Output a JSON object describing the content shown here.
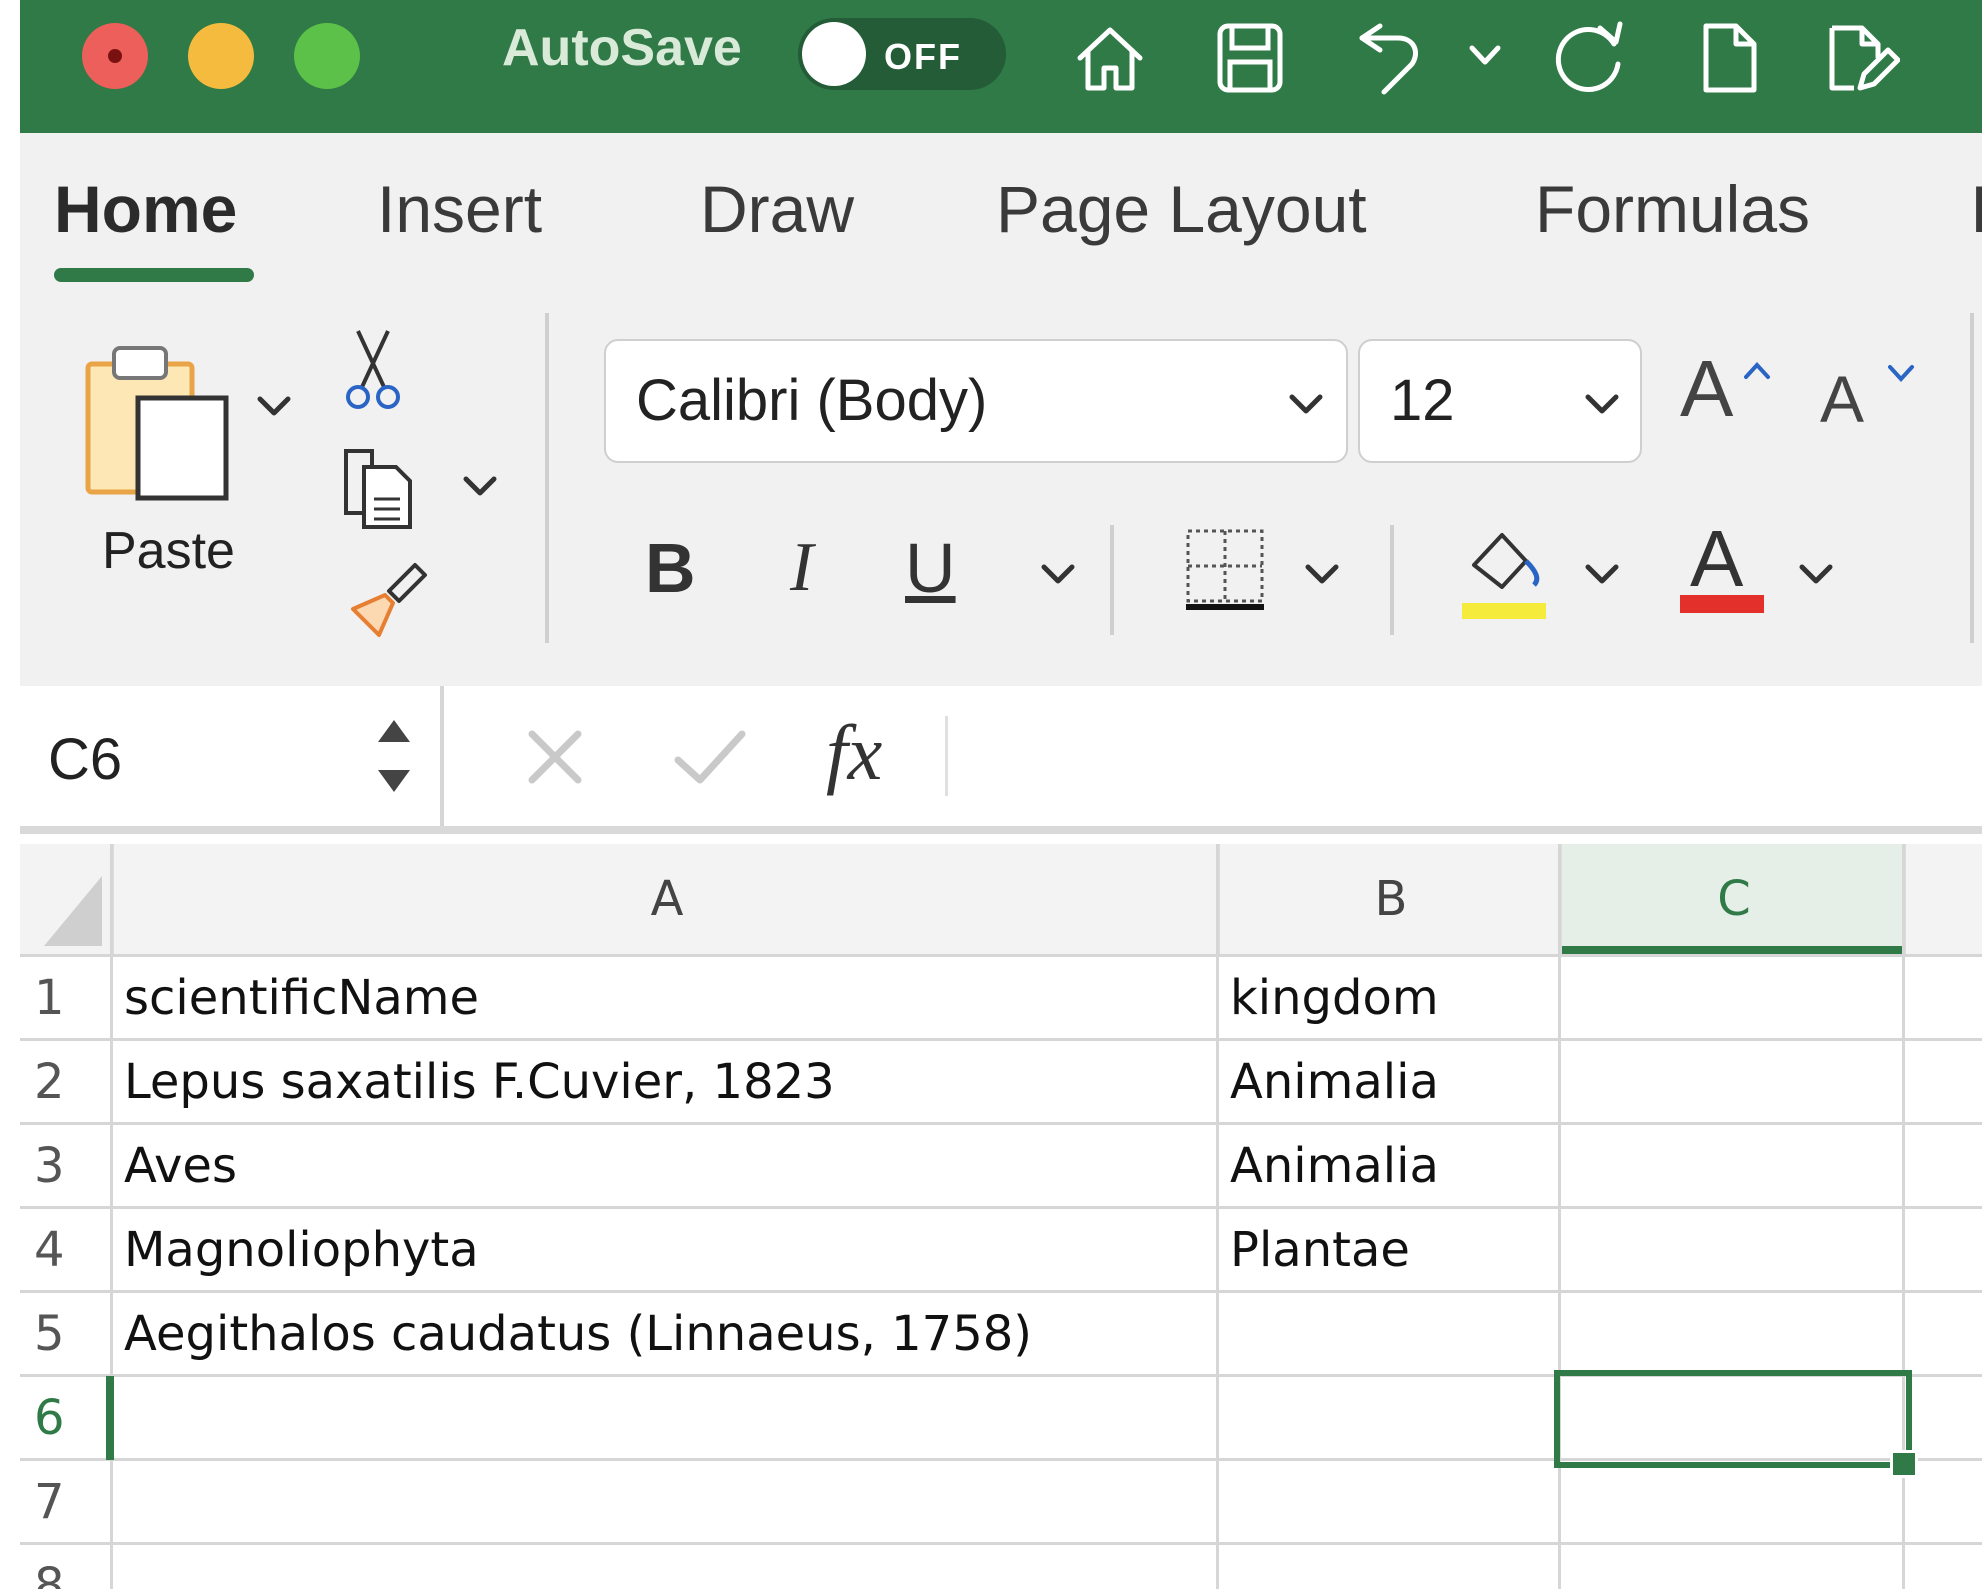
{
  "titlebar": {
    "autosave_label": "AutoSave",
    "autosave_state": "OFF",
    "accent": "#2f7a47",
    "icons": [
      "home-icon",
      "save-icon",
      "undo-icon",
      "undo-dropdown-icon",
      "redo-icon",
      "new-document-icon",
      "edit-document-icon"
    ]
  },
  "ribbon": {
    "tabs": [
      {
        "label": "Home",
        "active": true
      },
      {
        "label": "Insert"
      },
      {
        "label": "Draw"
      },
      {
        "label": "Page Layout"
      },
      {
        "label": "Formulas"
      }
    ],
    "paste_label": "Paste",
    "font_name": "Calibri (Body)",
    "font_size": "12",
    "bold_label": "B",
    "italic_label": "I",
    "underline_label": "U",
    "grow_font": "A",
    "shrink_font": "A",
    "font_color_label": "A",
    "highlight_color": "#f5eb3a",
    "font_color": "#e3302b"
  },
  "formula_bar": {
    "name_box": "C6",
    "fx_label": "fx",
    "formula": ""
  },
  "sheet": {
    "columns": [
      "A",
      "B",
      "C"
    ],
    "selected_column": "C",
    "selected_row": "6",
    "selected_cell": "C6",
    "rows": [
      {
        "num": "1",
        "A": "scientificName",
        "B": "kingdom",
        "C": ""
      },
      {
        "num": "2",
        "A": "Lepus saxatilis F.Cuvier, 1823",
        "B": "Animalia",
        "C": ""
      },
      {
        "num": "3",
        "A": "Aves",
        "B": "Animalia",
        "C": ""
      },
      {
        "num": "4",
        "A": "Magnoliophyta",
        "B": "Plantae",
        "C": ""
      },
      {
        "num": "5",
        "A": "Aegithalos caudatus (Linnaeus, 1758)",
        "B": "",
        "C": ""
      },
      {
        "num": "6",
        "A": "",
        "B": "",
        "C": ""
      },
      {
        "num": "7",
        "A": "",
        "B": "",
        "C": ""
      },
      {
        "num": "8",
        "A": "",
        "B": "",
        "C": ""
      }
    ]
  }
}
